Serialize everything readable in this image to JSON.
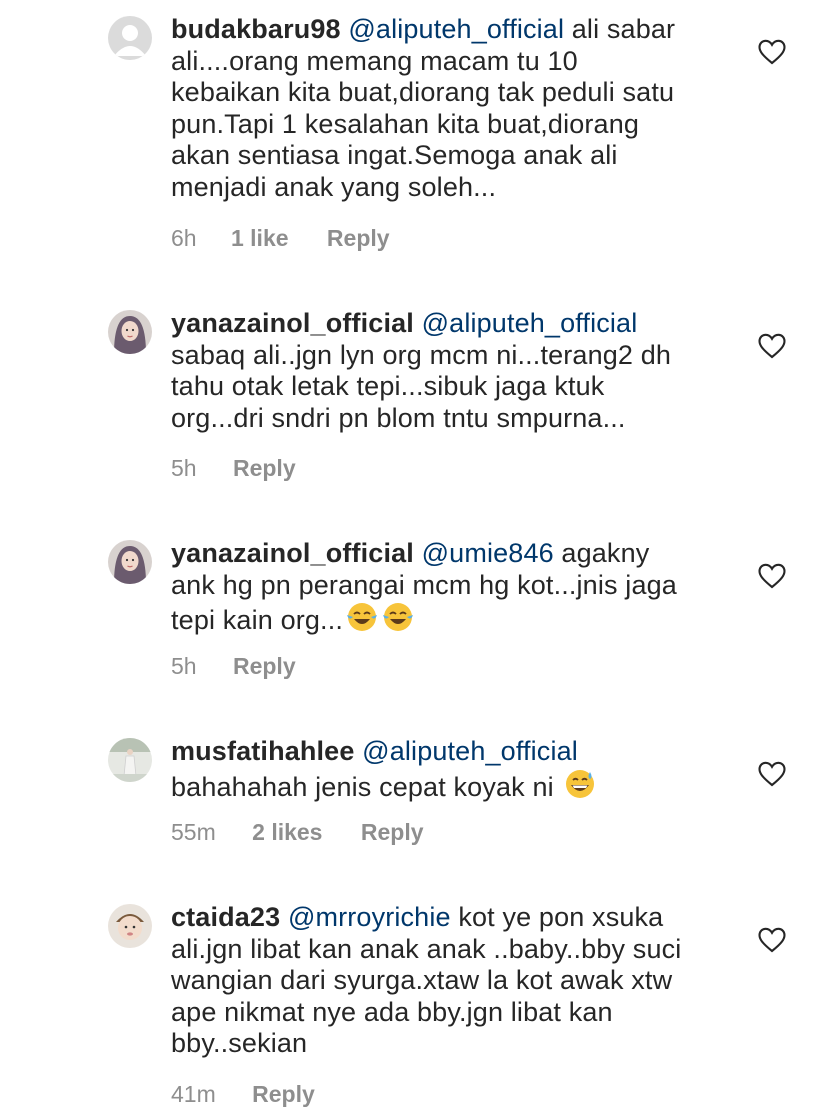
{
  "comments": [
    {
      "username": "budakbaru98",
      "mention": "@aliputeh_official",
      "lines": [
        " ali sabar",
        "ali....orang memang macam tu 10",
        "kebaikan kita buat,diorang tak peduli satu",
        "pun.Tapi 1 kesalahan kita buat,diorang",
        "akan sentiasa ingat.Semoga anak ali",
        "menjadi anak yang soleh..."
      ],
      "time": "6h",
      "likes": "1 like",
      "reply": "Reply",
      "avatar": "default-avatar"
    },
    {
      "username": "yanazainol_official",
      "mention": "@aliputeh_official",
      "lines": [
        "",
        "sabaq ali..jgn lyn org mcm ni...terang2 dh",
        "tahu otak letak tepi...sibuk jaga ktuk",
        "org...dri sndri pn blom tntu smpurna..."
      ],
      "time": "5h",
      "likes": "",
      "reply": "Reply",
      "avatar": "woman-hijab-avatar"
    },
    {
      "username": "yanazainol_official",
      "mention": "@umie846",
      "lines": [
        " agakny",
        "ank hg pn perangai mcm hg kot...jnis jaga",
        "tepi kain org..."
      ],
      "emoji_trailing": [
        "face-with-tears-of-joy",
        "face-with-tears-of-joy"
      ],
      "time": "5h",
      "likes": "",
      "reply": "Reply",
      "avatar": "woman-hijab-avatar"
    },
    {
      "username": "musfatihahlee",
      "mention": "@aliputeh_official",
      "lines": [
        "",
        "bahahahah jenis cepat koyak ni "
      ],
      "emoji_trailing": [
        "grinning-face-with-sweat"
      ],
      "time": "55m",
      "likes": "2 likes",
      "reply": "Reply",
      "avatar": "outdoor-figure-avatar"
    },
    {
      "username": "ctaida23",
      "mention": "@mrroyrichie",
      "lines": [
        " kot ye pon xsuka",
        "ali.jgn libat kan anak anak ..baby..bby suci",
        "wangian dari syurga.xtaw la kot awak xtw",
        "ape nikmat nye ada bby.jgn libat kan",
        "bby..sekian"
      ],
      "time": "41m",
      "likes": "",
      "reply": "Reply",
      "avatar": "baby-avatar"
    }
  ],
  "colors": {
    "text": "#262626",
    "mention": "#00376b",
    "meta": "#8e8e8e"
  },
  "icons": {
    "like": "heart-outline-icon"
  }
}
